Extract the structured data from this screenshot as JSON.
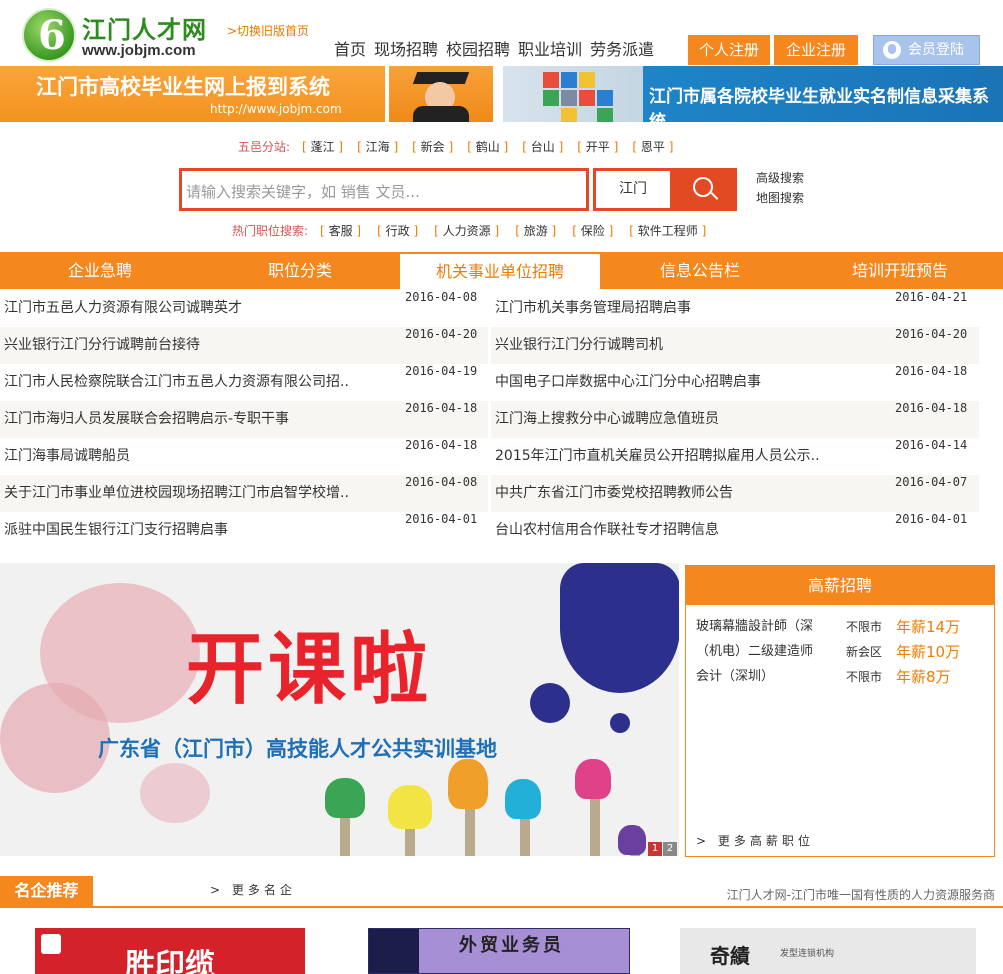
{
  "header": {
    "logo_title": "江门人才网",
    "logo_url": "www.jobjm.com",
    "switch_old": ">切换旧版首页",
    "nav": [
      "首页",
      "现场招聘",
      "校园招聘",
      "职业培训",
      "劳务派遣"
    ],
    "personal_register": "个人注册",
    "company_register": "企业注册",
    "member_login": "会员登陆"
  },
  "banners": {
    "left_title": "江门市高校毕业生网上报到系统",
    "left_url": "http://www.jobjm.com",
    "right_title": "江门市属各院校毕业生就业实名制信息采集系统"
  },
  "branches": {
    "label": "五邑分站:",
    "items": [
      "蓬江",
      "江海",
      "新会",
      "鹤山",
      "台山",
      "开平",
      "恩平"
    ]
  },
  "search": {
    "placeholder": "请输入搜索关键字，如 销售   文员...",
    "city": "江门",
    "advanced": "高级搜索",
    "map": "地图搜索"
  },
  "hot_jobs": {
    "label": "热门职位搜索:",
    "items": [
      "客服",
      "行政",
      "人力资源",
      "旅游",
      "保险",
      "软件工程师"
    ]
  },
  "tabs": [
    "企业急聘",
    "职位分类",
    "机关事业单位招聘",
    "信息公告栏",
    "培训开班预告"
  ],
  "news_left": [
    {
      "title": "江门市五邑人力资源有限公司诚聘英才",
      "date": "2016-04-08"
    },
    {
      "title": "兴业银行江门分行诚聘前台接待",
      "date": "2016-04-20"
    },
    {
      "title": "江门市人民检察院联合江门市五邑人力资源有限公司招..",
      "date": "2016-04-19"
    },
    {
      "title": "江门市海归人员发展联合会招聘启示-专职干事",
      "date": "2016-04-18"
    },
    {
      "title": "江门海事局诚聘船员",
      "date": "2016-04-18"
    },
    {
      "title": "关于江门市事业单位进校园现场招聘江门市启智学校增..",
      "date": "2016-04-08"
    },
    {
      "title": "派驻中国民生银行江门支行招聘启事",
      "date": "2016-04-01"
    }
  ],
  "news_right": [
    {
      "title": "江门市机关事务管理局招聘启事",
      "date": "2016-04-21"
    },
    {
      "title": "兴业银行江门分行诚聘司机",
      "date": "2016-04-20"
    },
    {
      "title": "中国电子口岸数据中心江门分中心招聘启事",
      "date": "2016-04-18"
    },
    {
      "title": "江门海上搜救分中心诚聘应急值班员",
      "date": "2016-04-18"
    },
    {
      "title": "2015年江门市直机关雇员公开招聘拟雇用人员公示..",
      "date": "2016-04-14"
    },
    {
      "title": "中共广东省江门市委党校招聘教师公告",
      "date": "2016-04-07"
    },
    {
      "title": "台山农村信用合作联社专才招聘信息",
      "date": "2016-04-01"
    }
  ],
  "promo": {
    "headline": "开课啦",
    "subtitle": "广东省（江门市）高技能人才公共实训基地",
    "pages": [
      "1",
      "2"
    ]
  },
  "high_salary": {
    "title": "高薪招聘",
    "items": [
      {
        "name": "玻璃幕牆設計師（深",
        "location": "不限市",
        "salary": "年薪14万"
      },
      {
        "name": "（机电）二级建造师",
        "location": "新会区",
        "salary": "年薪10万"
      },
      {
        "name": "会计（深圳）",
        "location": "不限市",
        "salary": "年薪8万"
      }
    ],
    "more": "> 更多高薪职位"
  },
  "famous": {
    "label": "名企推荐",
    "more": "> 更多名企",
    "slogan": "江门人才网-江门市唯一国有性质的人力资源服务商",
    "logos": [
      "胜印缆",
      "外贸业务员",
      "奇績",
      "发型连锁机构"
    ]
  },
  "colors": {
    "accent": "#f5871f",
    "search_red": "#e14a23",
    "brand_green": "#2e8b1f"
  }
}
